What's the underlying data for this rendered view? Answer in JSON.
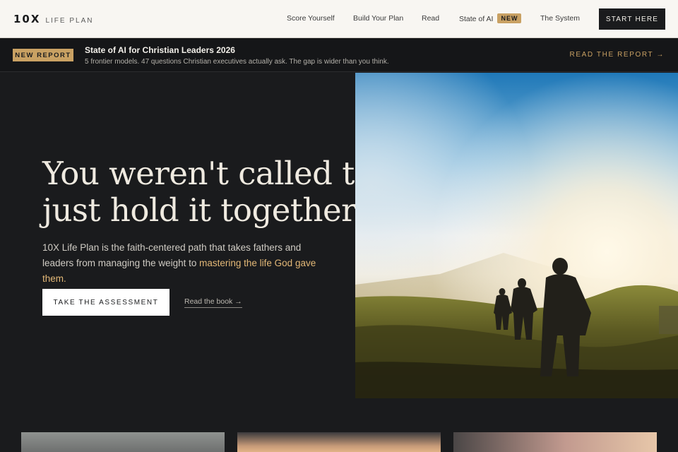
{
  "nav": {
    "logo_mark": "10X",
    "logo_text": "LIFE PLAN",
    "links": [
      "Score Yourself",
      "Build Your Plan",
      "Read",
      "State of AI",
      "The System"
    ],
    "state_badge": "NEW",
    "start_label": "START HERE"
  },
  "banner": {
    "badge": "NEW REPORT",
    "title": "State of AI for Christian Leaders 2026",
    "subtitle": "5 frontier models. 47 questions Christian executives actually ask. The gap is wider than you think.",
    "link": "READ THE REPORT →"
  },
  "hero": {
    "title_line1": "You weren't called to",
    "title_line2": "just hold it together.",
    "sub_pre": "10X Life Plan is the faith-centered path that takes fathers and leaders from managing the weight to ",
    "sub_accent": "mastering the life God gave them.",
    "cta": "TAKE THE ASSESSMENT",
    "book_link": "Read the book →"
  },
  "colors": {
    "accent": "#c9a163",
    "bg": "#1a1b1d",
    "nav_bg": "#f8f6f2"
  }
}
